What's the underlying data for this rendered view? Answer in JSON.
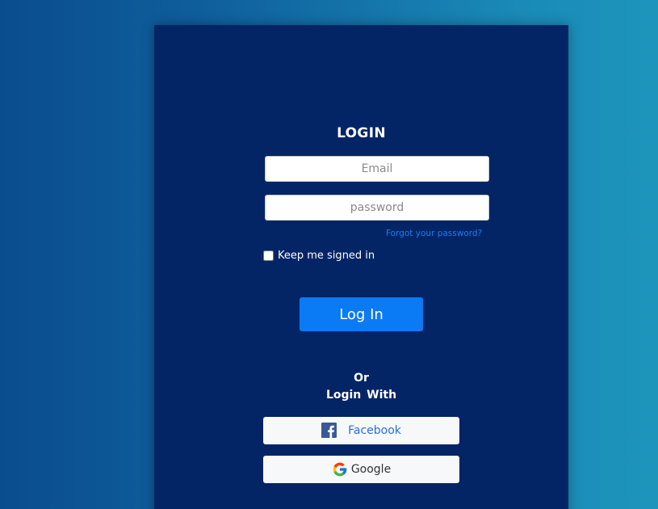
{
  "login": {
    "title": "LOGIN",
    "email_placeholder": "Email",
    "password_placeholder": "password",
    "forgot_password": "Forgot your password?",
    "keep_signed_in": "Keep me signed in",
    "login_button": "Log In",
    "or_text": "Or",
    "login_with_text": "Login With"
  },
  "social": {
    "facebook_label": "Facebook",
    "google_label": "Google",
    "facebook_icon": "facebook-icon",
    "google_icon": "google-icon"
  },
  "colors": {
    "card_bg": "#032566",
    "primary_button": "#0a7bf5",
    "link": "#1c7cf0",
    "facebook_text": "#2a6fdb"
  }
}
